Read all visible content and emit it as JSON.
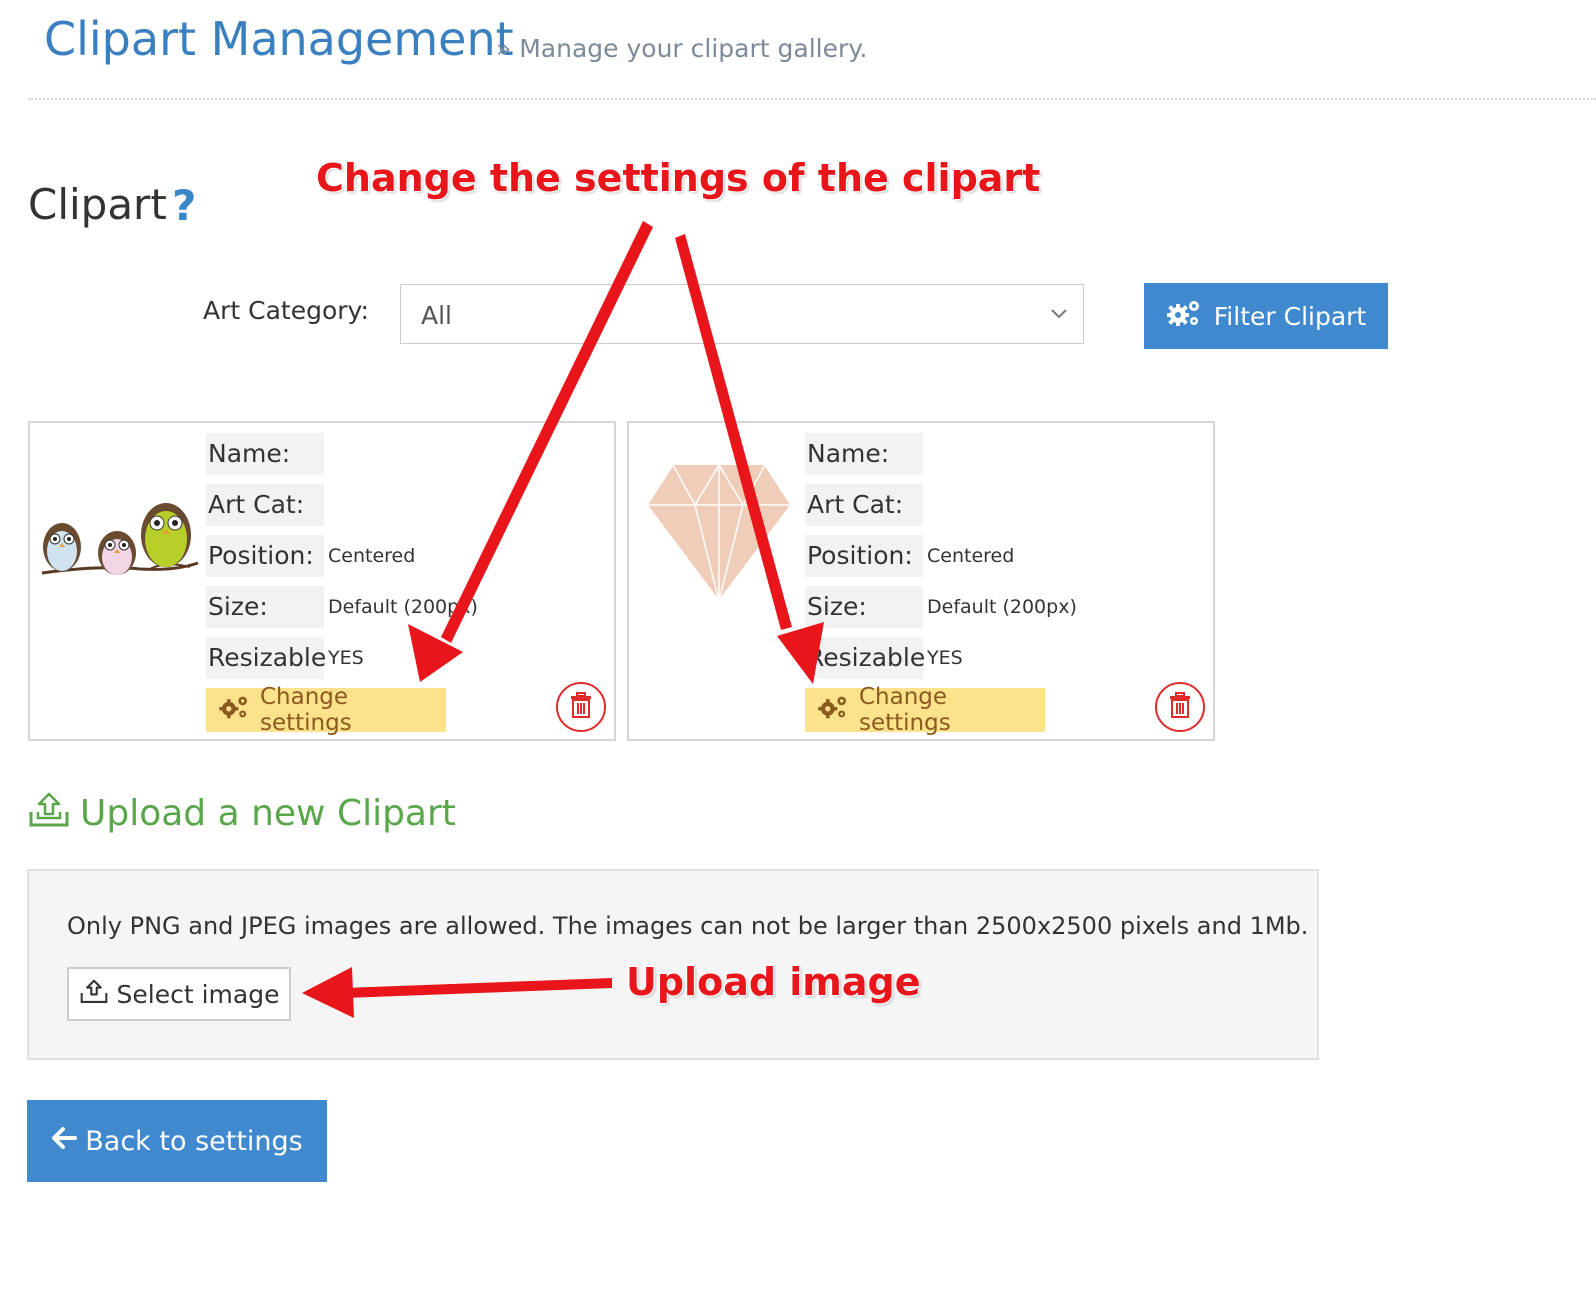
{
  "header": {
    "title": "Clipart Management",
    "subtitle": "» Manage your clipart gallery."
  },
  "section": {
    "title": "Clipart"
  },
  "filter": {
    "label": "Art Category:",
    "selected": "All",
    "button_label": "Filter Clipart"
  },
  "cliparts": [
    {
      "image": "owls-on-branch",
      "name_label": "Name:",
      "name_value": "",
      "artcat_label": "Art Cat:",
      "artcat_value": "",
      "position_label": "Position:",
      "position_value": "Centered",
      "size_label": "Size:",
      "size_value": "Default (200px)",
      "resizable_label": "Resizable",
      "resizable_value": "YES",
      "settings_label": "Change settings"
    },
    {
      "image": "diamond",
      "name_label": "Name:",
      "name_value": "",
      "artcat_label": "Art Cat:",
      "artcat_value": "",
      "position_label": "Position:",
      "position_value": "Centered",
      "size_label": "Size:",
      "size_value": "Default (200px)",
      "resizable_label": "Resizable",
      "resizable_value": "YES",
      "settings_label": "Change settings"
    }
  ],
  "upload": {
    "title": "Upload a new Clipart",
    "info": "Only PNG and JPEG images are allowed. The images can not be larger than 2500x2500 pixels and 1Mb.",
    "select_label": "Select image"
  },
  "back_label": "Back to settings",
  "annotations": {
    "settings_note": "Change the settings of the clipart",
    "upload_note": "Upload image",
    "color": "#e8161b"
  },
  "colors": {
    "primary": "#4089ce",
    "title": "#3a7fc0",
    "upload_green": "#5aa64a",
    "settings_bg": "#fce28a",
    "delete_red": "#e02b2b"
  },
  "icons": [
    "help-icon",
    "chevron-down-icon",
    "gears-icon",
    "trash-icon",
    "upload-icon",
    "arrow-left-icon"
  ]
}
